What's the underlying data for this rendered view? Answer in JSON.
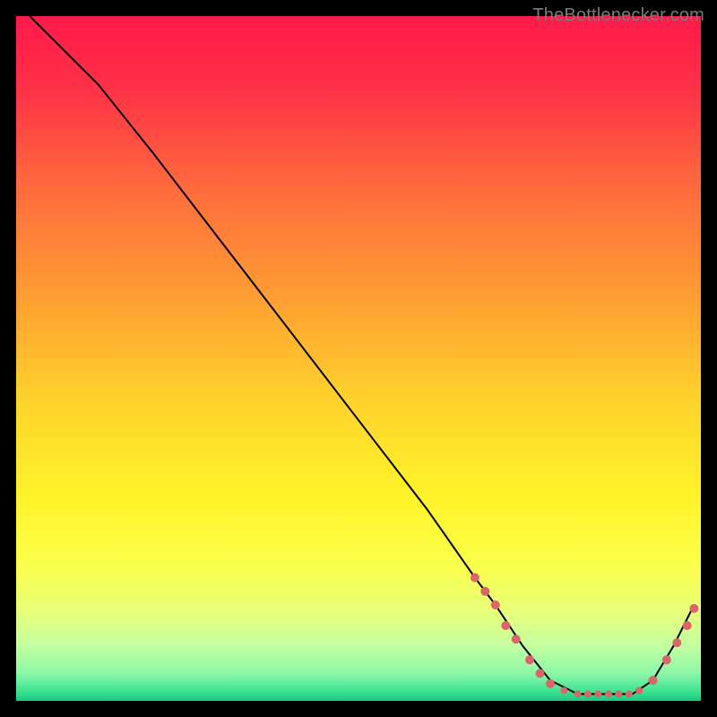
{
  "watermark": "TheBottlenecker.com",
  "chart_data": {
    "type": "line",
    "title": "",
    "xlabel": "",
    "ylabel": "",
    "xlim": [
      0,
      100
    ],
    "ylim": [
      0,
      100
    ],
    "grid": false,
    "legend": false,
    "series": [
      {
        "name": "curve",
        "x": [
          2,
          5,
          8,
          12,
          20,
          30,
          40,
          50,
          60,
          67,
          70,
          74,
          78,
          82,
          86,
          90,
          93,
          96,
          99
        ],
        "y": [
          100,
          97,
          94,
          90,
          80,
          67,
          54,
          41,
          28,
          18,
          14,
          8,
          3,
          1,
          1,
          1,
          3,
          8,
          14
        ]
      }
    ],
    "markers": [
      {
        "x": 67,
        "y": 18
      },
      {
        "x": 68.5,
        "y": 16
      },
      {
        "x": 70,
        "y": 14
      },
      {
        "x": 71.5,
        "y": 11
      },
      {
        "x": 73,
        "y": 9
      },
      {
        "x": 75,
        "y": 6
      },
      {
        "x": 76.5,
        "y": 4
      },
      {
        "x": 78,
        "y": 2.5
      },
      {
        "x": 80,
        "y": 1.5
      },
      {
        "x": 82,
        "y": 1
      },
      {
        "x": 83.5,
        "y": 1
      },
      {
        "x": 85,
        "y": 1
      },
      {
        "x": 86.5,
        "y": 1
      },
      {
        "x": 88,
        "y": 1
      },
      {
        "x": 89.5,
        "y": 1
      },
      {
        "x": 91,
        "y": 1.5
      },
      {
        "x": 93,
        "y": 3
      },
      {
        "x": 95,
        "y": 6
      },
      {
        "x": 96.5,
        "y": 8.5
      },
      {
        "x": 98,
        "y": 11
      },
      {
        "x": 99,
        "y": 13.5
      }
    ],
    "gradient_stops": [
      {
        "offset": 0,
        "color": "#ff1a4a"
      },
      {
        "offset": 0.1,
        "color": "#ff2f47"
      },
      {
        "offset": 0.25,
        "color": "#ff6a3d"
      },
      {
        "offset": 0.4,
        "color": "#ff9a33"
      },
      {
        "offset": 0.55,
        "color": "#ffcf2c"
      },
      {
        "offset": 0.7,
        "color": "#fff329"
      },
      {
        "offset": 0.8,
        "color": "#fbff4a"
      },
      {
        "offset": 0.87,
        "color": "#e7ff7a"
      },
      {
        "offset": 0.92,
        "color": "#c3ffa0"
      },
      {
        "offset": 0.96,
        "color": "#8cf7a8"
      },
      {
        "offset": 0.985,
        "color": "#3fe493"
      },
      {
        "offset": 1.0,
        "color": "#19c97e"
      }
    ],
    "marker_color": "#d9666b",
    "line_color": "#000000"
  }
}
